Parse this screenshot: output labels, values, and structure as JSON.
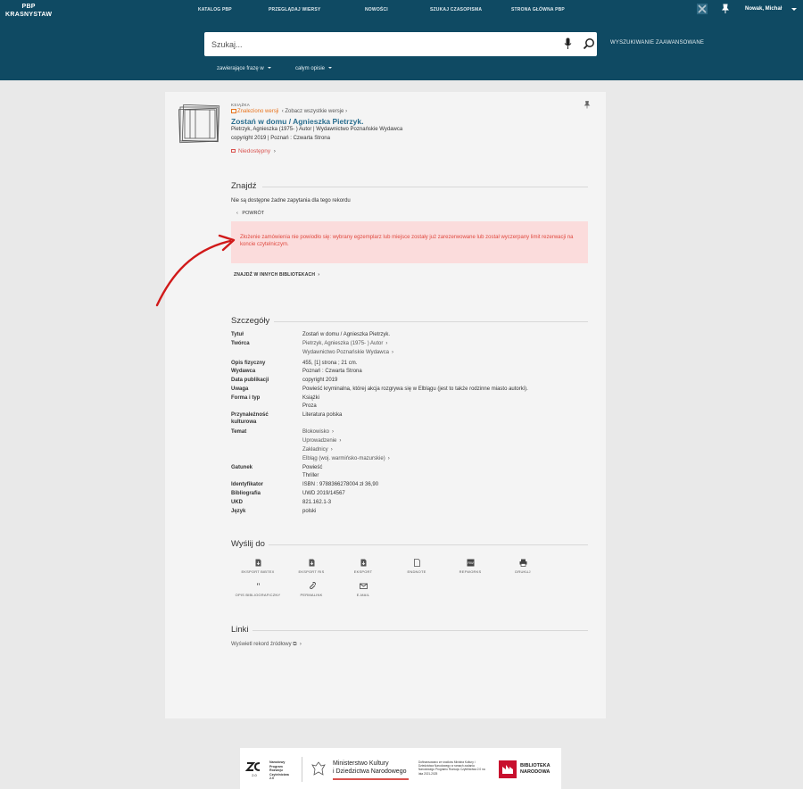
{
  "header": {
    "logo_line1": "PBP",
    "logo_line2": "KRASNYSTAW",
    "nav": [
      "KATALOG PBP",
      "PRZEGLĄDAJ WIERSY",
      "NOWOŚCI",
      "SZUKAJ CZASOPISMA",
      "STRONA GŁÓWNA PBP"
    ],
    "user_name": "Nowak, Michał",
    "search_placeholder": "Szukaj...",
    "advanced_search": "WYSZUKIWANIE ZAAWANSOWANE",
    "filter_phrase": "zawierające frazę w",
    "filter_scope": "całym opisie"
  },
  "record": {
    "type": "KSIĄŻKA",
    "edition_link": "Znaleziono wersji",
    "all_versions": "Zobacz wszystkie wersje",
    "title": "Zostań w domu / Agnieszka Pietrzyk.",
    "line1": "Pietrzyk, Agnieszka (1975- ) Autor | Wydawnictwo Poznańskie Wydawca",
    "line2": "copyright 2019 | Poznań : Czwarta Strona",
    "availability": "Niedostępny"
  },
  "find": {
    "title": "Znajdź",
    "no_requests": "Nie są dostępne żadne zapytania dla tego rekordu",
    "back": "POWRÓT",
    "alert": "Złożenie zamówienia nie powiodło się: wybrany egzemplarz lub miejsce zostały już zarezerwowane lub został wyczerpany limit rezerwacji na koncie czytelniczym.",
    "other_libraries": "ZNAJDŹ W INNYCH BIBLIOTEKACH"
  },
  "details": {
    "title": "Szczegóły",
    "rows": [
      {
        "label": "Tytuł",
        "values": [
          "Zostań w domu / Agnieszka Pietrzyk."
        ]
      },
      {
        "label": "Twórca",
        "values": [
          "Pietrzyk, Agnieszka (1975- ) Autor",
          "Wydawnictwo Poznańskie Wydawca"
        ]
      },
      {
        "label": "Opis fizyczny",
        "values": [
          "455, [1] strona ; 21 cm."
        ]
      },
      {
        "label": "Wydawca",
        "values": [
          "Poznań : Czwarta Strona"
        ]
      },
      {
        "label": "Data publikacji",
        "values": [
          "copyright 2019"
        ]
      },
      {
        "label": "Uwaga",
        "values": [
          "Powieść kryminalna, której akcja rozgrywa się w Elblągu (jest to także rodzinne miasto autorki)."
        ]
      },
      {
        "label": "Forma i typ",
        "values": [
          "Książki",
          "Proza"
        ]
      },
      {
        "label": "Przynależność kulturowa",
        "values": [
          "Literatura polska"
        ]
      },
      {
        "label": "Temat",
        "values": [
          "Blokowisko",
          "Uprowadzenie",
          "Zakładnicy",
          "Elbląg (woj. warmińsko-mazurskie)"
        ]
      },
      {
        "label": "Gatunek",
        "values": [
          "Powieść",
          "Thriller"
        ]
      },
      {
        "label": "Identyfikator",
        "values": [
          "ISBN : 9788366278004 zł 36,90"
        ]
      },
      {
        "label": "Bibliografia",
        "values": [
          "UWD 2019/14567"
        ]
      },
      {
        "label": "UKD",
        "values": [
          "821.162.1-3"
        ]
      },
      {
        "label": "Język",
        "values": [
          "polski"
        ]
      }
    ]
  },
  "send_to": {
    "title": "Wyślij do",
    "items": [
      "EKSPORT BIBTEX",
      "EKSPORT RIS",
      "EKSPORT",
      "ENDNOTE",
      "REFWORKS",
      "DRUKUJ",
      "OPIS BIBLIOGRAFICZNY",
      "PERMALINK",
      "E-MAIL"
    ]
  },
  "links": {
    "title": "Linki",
    "source_record": "Wyświetl rekord źródłowy"
  },
  "footer": {
    "program": "Narodowy Program Rozwoju Czytelnictwa 2.0",
    "ministry_line1": "Ministerstwo Kultury",
    "ministry_line2": "i Dziedzictwa Narodowego",
    "funding": "Dofinansowano ze środków Ministra Kultury i Dziedzictwa Narodowego w ramach zadania Narodowego Programu Rozwoju Czytelnictwa 2.0 na lata 2021-2025",
    "library_line1": "BIBLIOTEKA",
    "library_line2": "NARODOWA"
  },
  "colors": {
    "header": "#0f4a63",
    "accent_link": "#2a6e8f",
    "alert_bg": "#fbdcdc",
    "alert_text": "#e0493f",
    "unavailable": "#d9534f"
  }
}
